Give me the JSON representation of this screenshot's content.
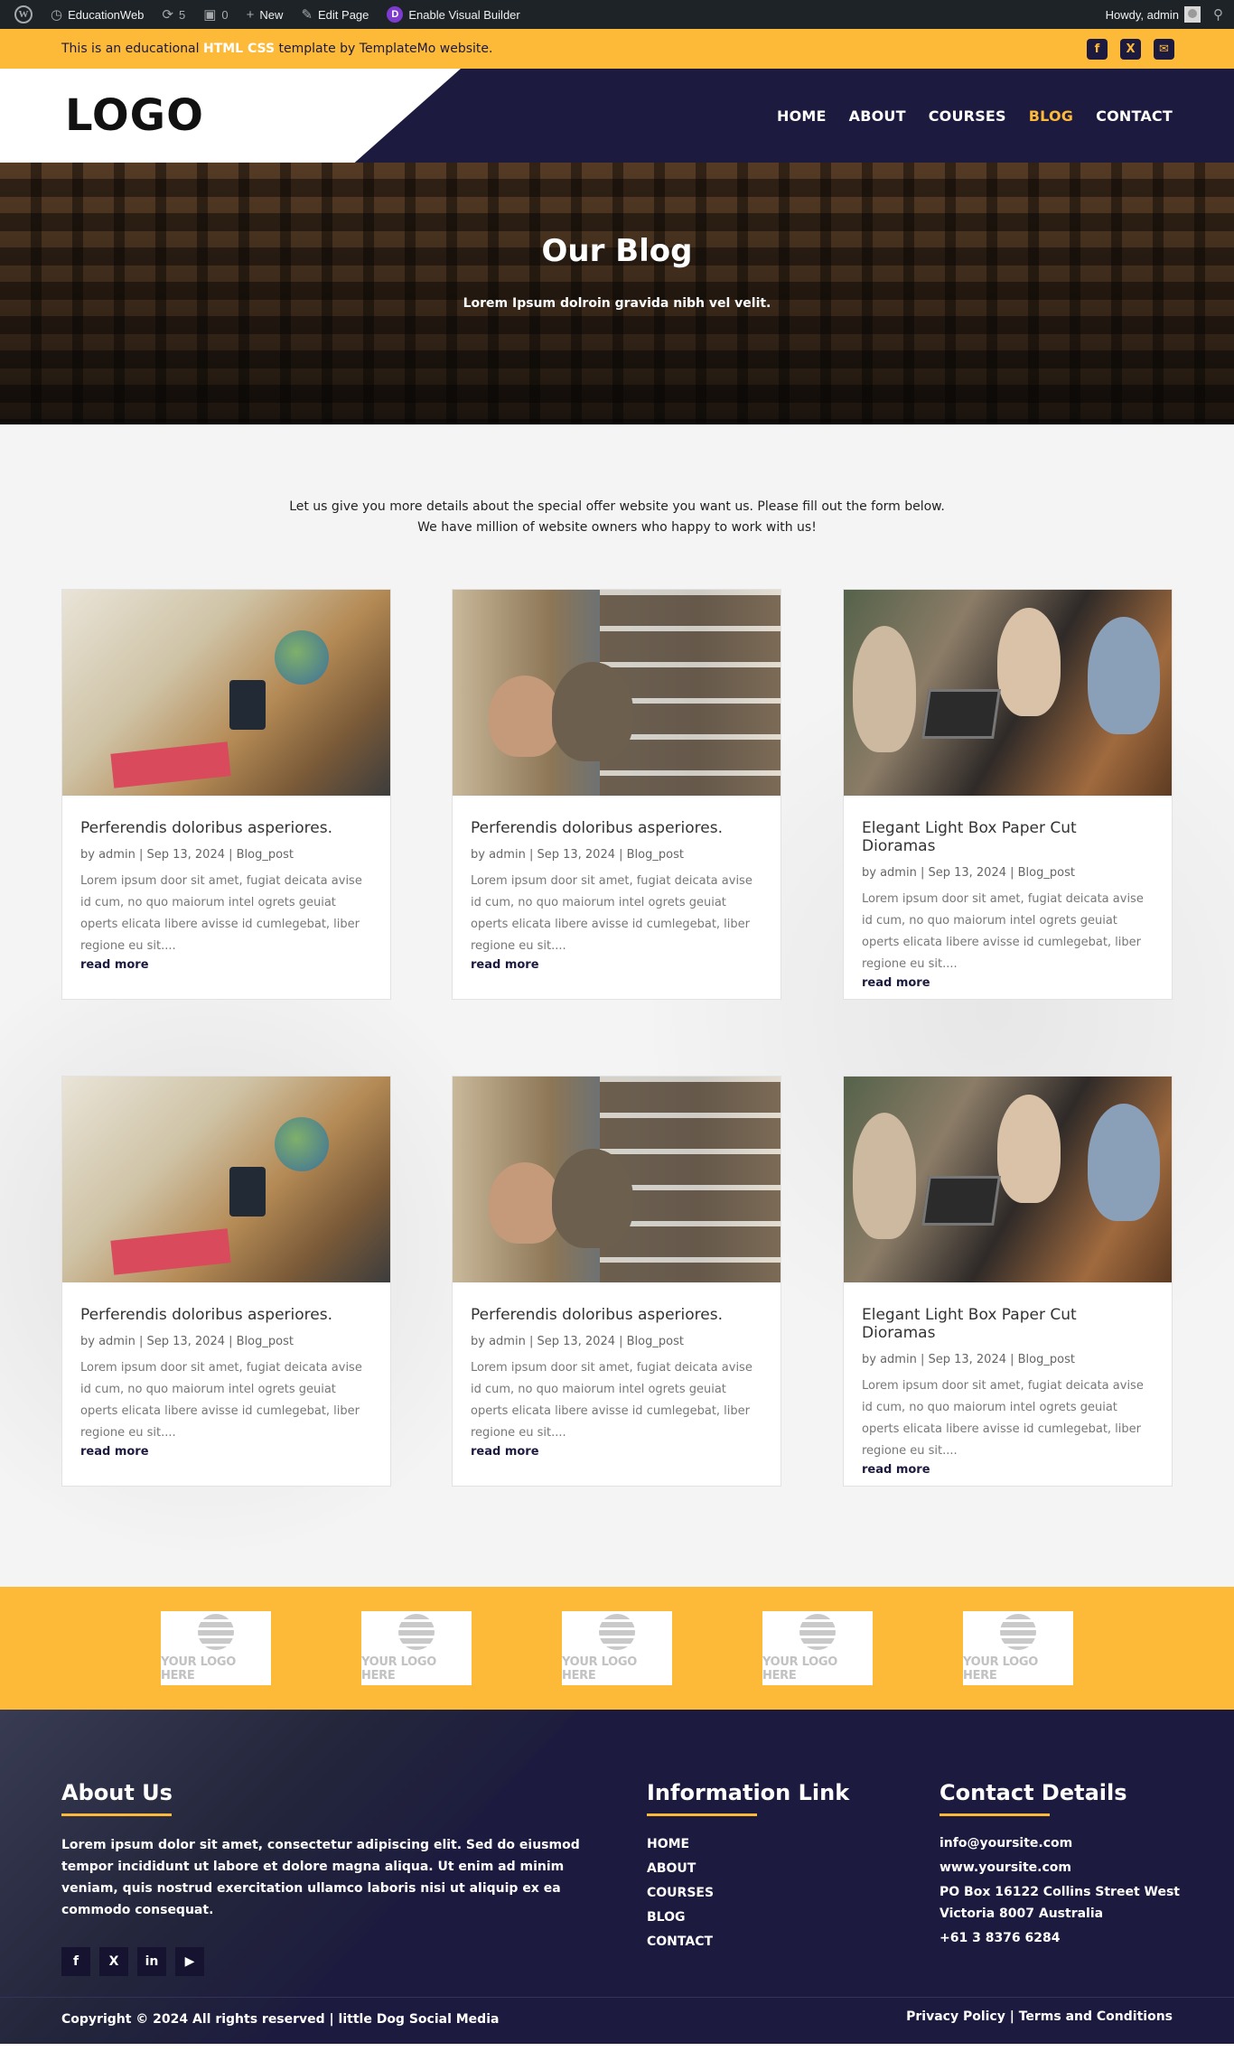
{
  "admin_bar": {
    "site_name": "EducationWeb",
    "updates_count": "5",
    "comments_count": "0",
    "new_label": "New",
    "edit_label": "Edit Page",
    "builder_label": "Enable Visual Builder",
    "howdy": "Howdy, admin"
  },
  "topbar": {
    "text_before": "This is an educational ",
    "highlight": "HTML CSS",
    "text_after": " template by TemplateMo website.",
    "social_icons": [
      "facebook-icon",
      "x-icon",
      "envelope-icon"
    ]
  },
  "header": {
    "logo": "LOGO",
    "nav": [
      "HOME",
      "ABOUT",
      "COURSES",
      "BLOG",
      "CONTACT"
    ],
    "active": "BLOG"
  },
  "hero": {
    "title": "Our Blog",
    "subtitle": "Lorem Ipsum dolroin gravida nibh vel velit."
  },
  "intro": {
    "line1": "Let us give you more details about the special offer website you want us. Please fill out the form below.",
    "line2": "We have million of website owners who happy to work with us!"
  },
  "posts": [
    {
      "title": "Perferendis doloribus asperiores.",
      "meta": "by admin | Sep 13, 2024 | Blog_post",
      "excerpt": "Lorem ipsum door sit amet, fugiat deicata avise id cum, no quo maiorum intel ogrets geuiat operts elicata libere avisse id cumlegebat, liber regione eu sit....",
      "more": "read more"
    },
    {
      "title": "Perferendis doloribus asperiores.",
      "meta": "by admin | Sep 13, 2024 | Blog_post",
      "excerpt": "Lorem ipsum door sit amet, fugiat deicata avise id cum, no quo maiorum intel ogrets geuiat operts elicata libere avisse id cumlegebat, liber regione eu sit....",
      "more": "read more"
    },
    {
      "title": "Elegant Light Box Paper Cut Dioramas",
      "meta": "by admin | Sep 13, 2024 | Blog_post",
      "excerpt": "Lorem ipsum door sit amet, fugiat deicata avise id cum, no quo maiorum intel ogrets geuiat operts elicata libere avisse id cumlegebat, liber regione eu sit....",
      "more": "read more"
    },
    {
      "title": "Perferendis doloribus asperiores.",
      "meta": "by admin | Sep 13, 2024 | Blog_post",
      "excerpt": "Lorem ipsum door sit amet, fugiat deicata avise id cum, no quo maiorum intel ogrets geuiat operts elicata libere avisse id cumlegebat, liber regione eu sit....",
      "more": "read more"
    },
    {
      "title": "Perferendis doloribus asperiores.",
      "meta": "by admin | Sep 13, 2024 | Blog_post",
      "excerpt": "Lorem ipsum door sit amet, fugiat deicata avise id cum, no quo maiorum intel ogrets geuiat operts elicata libere avisse id cumlegebat, liber regione eu sit....",
      "more": "read more"
    },
    {
      "title": "Elegant Light Box Paper Cut Dioramas",
      "meta": "by admin | Sep 13, 2024 | Blog_post",
      "excerpt": "Lorem ipsum door sit amet, fugiat deicata avise id cum, no quo maiorum intel ogrets geuiat operts elicata libere avisse id cumlegebat, liber regione eu sit....",
      "more": "read more"
    }
  ],
  "partners": {
    "logo_text": "YOUR LOGO HERE"
  },
  "footer": {
    "about_title": "About Us",
    "about_text": "Lorem ipsum dolor sit amet, consectetur adipiscing elit. Sed do eiusmod tempor incididunt ut labore et dolore magna aliqua. Ut enim ad minim veniam, quis nostrud exercitation ullamco laboris nisi ut aliquip ex ea commodo consequat.",
    "social_icons": [
      "facebook-icon",
      "x-icon",
      "linkedin-icon",
      "youtube-icon"
    ],
    "links_title": "Information Link",
    "links": [
      "HOME",
      "ABOUT",
      "COURSES",
      "BLOG",
      "CONTACT"
    ],
    "contact_title": "Contact Details",
    "contact": [
      "info@yoursite.com",
      "www.yoursite.com",
      "PO Box 16122 Collins Street West",
      "Victoria 8007 Australia",
      "+61 3 8376 6284"
    ],
    "copyright": "Copyright © 2024 All rights reserved | little Dog Social Media",
    "legal": "Privacy Policy | Terms and Conditions"
  },
  "colors": {
    "accent": "#fdb938",
    "navy": "#1c1a3f",
    "admin_bar": "#1d2327"
  }
}
